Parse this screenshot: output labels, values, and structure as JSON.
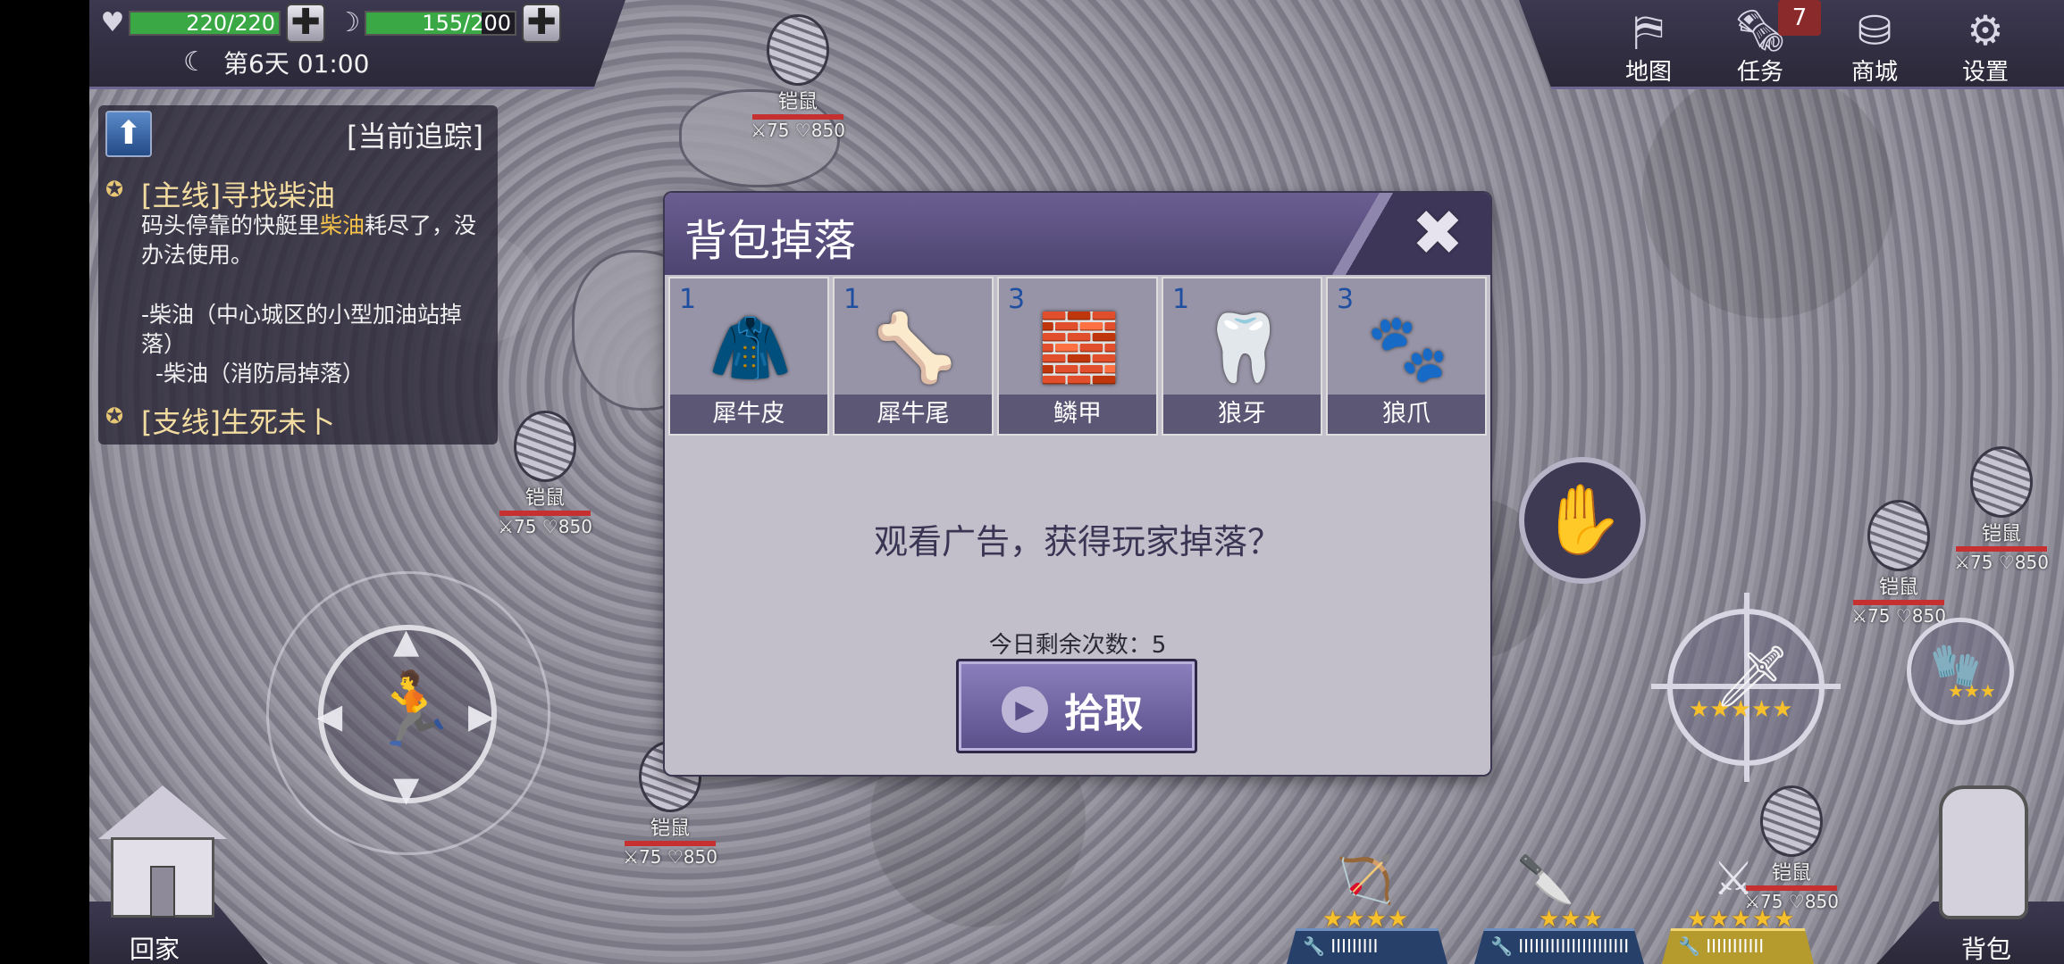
{
  "hud": {
    "hp": {
      "icon": "heart-icon",
      "value": "220/220",
      "fill": 1.0
    },
    "stamina": {
      "icon": "stomach-icon",
      "value": "155/200",
      "fill": 0.775
    },
    "plus_symbol": "✚",
    "day": "第6天 01:00"
  },
  "menu": {
    "map": "地图",
    "tasks": "任务",
    "shop": "商城",
    "settings": "设置",
    "task_badge": "7"
  },
  "quest": {
    "header": "[当前追踪]",
    "main_title": "[主线]寻找柴油",
    "main_desc_1": "码头停靠的快艇里",
    "main_desc_highlight": "柴油",
    "main_desc_2": "耗尽了，没办法使用。",
    "main_line_3": "-柴油（中心城区的小型加油站掉落）",
    "main_line_4": "-柴油（消防局掉落）",
    "side_title": "[支线]生死未卜"
  },
  "mobs": [
    {
      "name": "铠鼠",
      "atk": "75",
      "hp": "850"
    },
    {
      "name": "铠鼠",
      "atk": "75",
      "hp": "850"
    },
    {
      "name": "铠鼠",
      "atk": "75",
      "hp": "850"
    },
    {
      "name": "铠鼠",
      "atk": "75",
      "hp": "850"
    },
    {
      "name": "铠鼠",
      "atk": "75",
      "hp": "850"
    },
    {
      "name": "铠鼠",
      "atk": "75",
      "hp": "850"
    }
  ],
  "bottom": {
    "home": "回家",
    "bag": "背包",
    "weapon_stars_1": "★★★★",
    "weapon_stars_2": "★★★",
    "weapon_stars_3": "★★★★★",
    "attack_stars": "★★★★★",
    "small_stars": "★★★",
    "durability_1": "🔧 IIIIIIIII",
    "durability_2": "🔧 IIIIIIIIIIIIIIIIIIIII",
    "durability_3": "🔧 IIIIIIIIIII"
  },
  "modal": {
    "title": "背包掉落",
    "close_symbol": "✖",
    "items": [
      {
        "qty": "1",
        "name": "犀牛皮",
        "icon": "hide-icon",
        "glyph": "🧥"
      },
      {
        "qty": "1",
        "name": "犀牛尾",
        "icon": "tail-icon",
        "glyph": "🦴"
      },
      {
        "qty": "3",
        "name": "鳞甲",
        "icon": "scale-armor-icon",
        "glyph": "🧱"
      },
      {
        "qty": "1",
        "name": "狼牙",
        "icon": "wolf-fang-icon",
        "glyph": "🦷"
      },
      {
        "qty": "3",
        "name": "狼爪",
        "icon": "wolf-claw-icon",
        "glyph": "🐾"
      }
    ],
    "question": "观看广告，获得玩家掉落？",
    "remaining": "今日剩余次数：5",
    "pick_label": "拾取"
  },
  "colors": {
    "accent": "#5b4f8a",
    "hp_fill": "#3aa844",
    "star": "#f5c02b",
    "quest_highlight": "#f5c34b",
    "qty_blue": "#1f4fa0"
  }
}
